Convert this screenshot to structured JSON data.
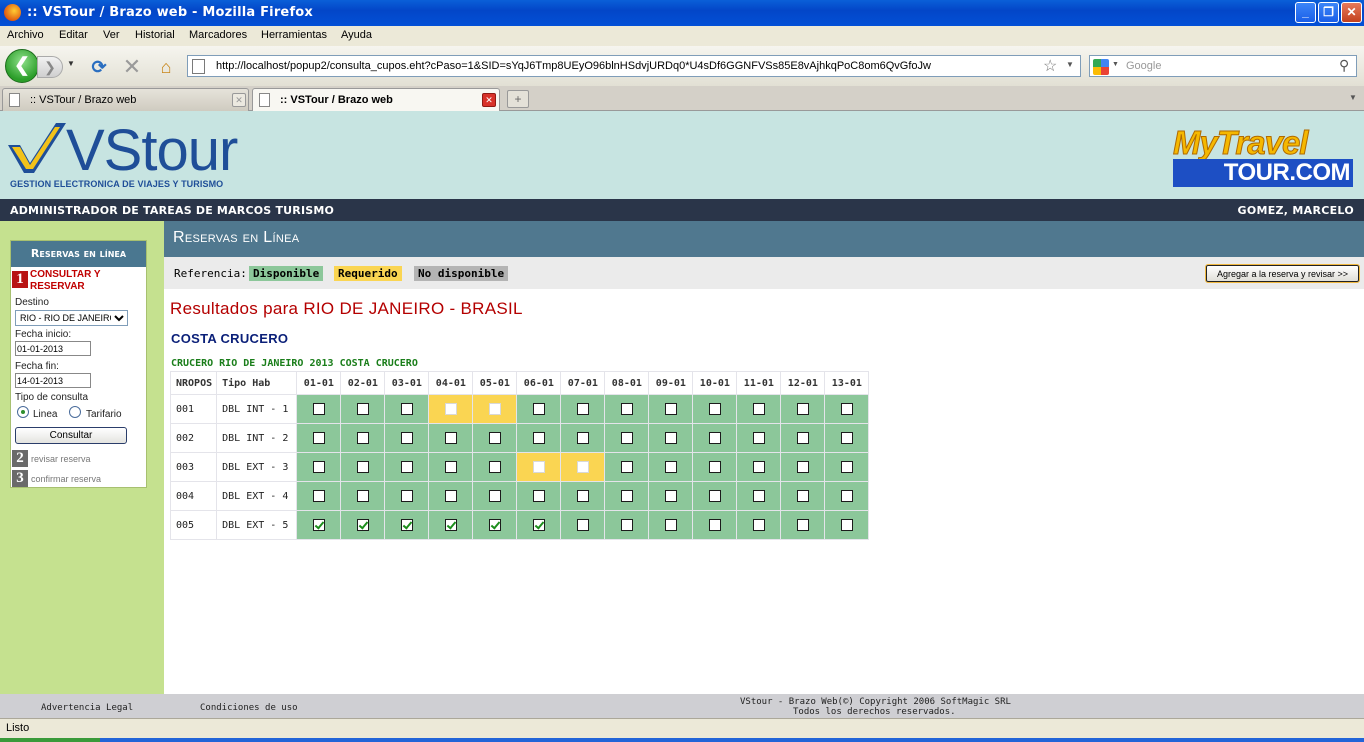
{
  "window": {
    "title": ":: VSTour / Brazo web - Mozilla Firefox"
  },
  "menu": {
    "items": [
      "Archivo",
      "Editar",
      "Ver",
      "Historial",
      "Marcadores",
      "Herramientas",
      "Ayuda"
    ]
  },
  "nav": {
    "url": "http://localhost/popup2/consulta_cupos.eht?cPaso=1&SID=sYqJ6Tmp8UEyO96blnHSdvjURDq0*U4sDf6GGNFVSs85E8vAjhkqPoC8om6QvGfoJw",
    "search_placeholder": "Google"
  },
  "tabs": [
    {
      "title": ":: VSTour / Brazo web",
      "active": false
    },
    {
      "title": ":: VSTour / Brazo web",
      "active": true
    }
  ],
  "header": {
    "logo_main": "VStour",
    "logo_sub": "GESTION ELECTRONICA DE VIAJES Y TURISMO",
    "partner_top": "MyTravel",
    "partner_bottom": "TOUR.COM",
    "admin_label": "ADMINISTRADOR DE TAREAS DE MARCOS TURISMO",
    "user": "GOMEZ, MARCELO"
  },
  "sidebar": {
    "title": "Reservas en línea",
    "step1_num": "1",
    "step1_label": "CONSULTAR Y RESERVAR",
    "destino_label": "Destino",
    "destino_value": "RIO - RIO DE JANEIRO",
    "fecha_inicio_label": "Fecha inicio:",
    "fecha_inicio_value": "01-01-2013",
    "fecha_fin_label": "Fecha fin:",
    "fecha_fin_value": "14-01-2013",
    "tipo_label": "Tipo de consulta",
    "tipo_linea": "Linea",
    "tipo_tarifario": "Tarifario",
    "consultar": "Consultar",
    "step2_num": "2",
    "step2_label": "revisar reserva",
    "step3_num": "3",
    "step3_label": "confirmar reserva"
  },
  "section": {
    "title": "Reservas en Línea"
  },
  "reference": {
    "label": "Referencia:",
    "disponible": "Disponible",
    "requerido": "Requerido",
    "no_disponible": "No disponible",
    "agregar": "Agregar a la reserva y revisar >>"
  },
  "colors": {
    "disponible": "#8cc79a",
    "requerido": "#fad552",
    "no_disponible": "#b4b4b4",
    "accent": "#50788f"
  },
  "results": {
    "title": "Resultados para RIO DE JANEIRO - BRASIL",
    "ship": "COSTA CRUCERO",
    "cruise": "CRUCERO RIO DE JANEIRO 2013 COSTA CRUCERO",
    "col_nropos": "NROPOS",
    "col_tipo": "Tipo Hab",
    "dates": [
      "01-01",
      "02-01",
      "03-01",
      "04-01",
      "05-01",
      "06-01",
      "07-01",
      "08-01",
      "09-01",
      "10-01",
      "11-01",
      "12-01",
      "13-01"
    ],
    "rows": [
      {
        "nro": "001",
        "tipo": "DBL INT - 1",
        "cells": [
          "g",
          "g",
          "g",
          "y",
          "y",
          "g",
          "g",
          "g",
          "g",
          "g",
          "g",
          "g",
          "g"
        ],
        "checked": []
      },
      {
        "nro": "002",
        "tipo": "DBL INT - 2",
        "cells": [
          "g",
          "g",
          "g",
          "g",
          "g",
          "g",
          "g",
          "g",
          "g",
          "g",
          "g",
          "g",
          "g"
        ],
        "checked": []
      },
      {
        "nro": "003",
        "tipo": "DBL EXT - 3",
        "cells": [
          "g",
          "g",
          "g",
          "g",
          "g",
          "y",
          "y",
          "g",
          "g",
          "g",
          "g",
          "g",
          "g"
        ],
        "checked": []
      },
      {
        "nro": "004",
        "tipo": "DBL EXT - 4",
        "cells": [
          "g",
          "g",
          "g",
          "g",
          "g",
          "g",
          "g",
          "g",
          "g",
          "g",
          "g",
          "g",
          "g"
        ],
        "checked": []
      },
      {
        "nro": "005",
        "tipo": "DBL EXT - 5",
        "cells": [
          "g",
          "g",
          "g",
          "g",
          "g",
          "g",
          "g",
          "g",
          "g",
          "g",
          "g",
          "g",
          "g"
        ],
        "checked": [
          0,
          1,
          2,
          3,
          4,
          5
        ]
      }
    ]
  },
  "footer": {
    "legal": "Advertencia Legal",
    "conditions": "Condiciones de uso",
    "copyright1": "VStour - Brazo Web(©) Copyright 2006 SoftMagic SRL",
    "copyright2": "Todos los derechos reservados."
  },
  "status": {
    "text": "Listo"
  }
}
